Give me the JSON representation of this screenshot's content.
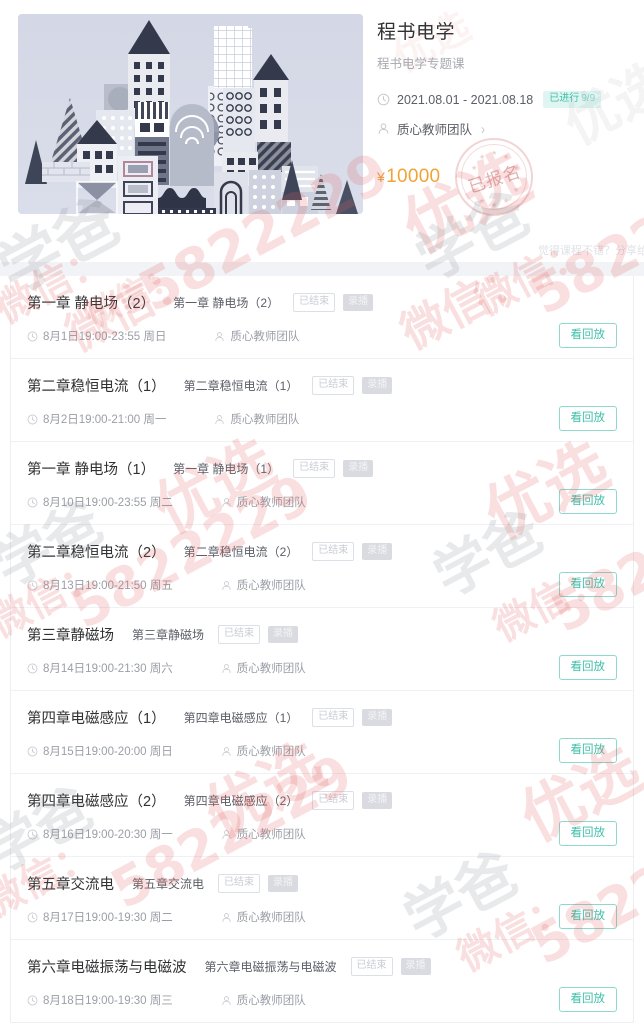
{
  "course": {
    "title": "程书电学",
    "subtitle": "程书电学专题课",
    "date_range": "2021.08.01 - 2021.08.18",
    "progress_label": "已进行",
    "progress_value": "9/9",
    "teacher": "质心教师团队",
    "chevron": "›",
    "price": "10000",
    "currency": "¥",
    "stamp_text": "已报名",
    "share_hint": "觉得课程不错？分享给",
    "clock_icon": "clock-icon",
    "person_icon": "person-icon",
    "hero_image_alt": "city-illustration"
  },
  "lessons": [
    {
      "title": "第一章 静电场（2）",
      "subtitle": "第一章 静电场（2）",
      "status_tag": "已结束",
      "type_tag": "录播",
      "datetime": "8月1日19:00-23:55 周日",
      "teacher": "质心教师团队",
      "action": "看回放"
    },
    {
      "title": "第二章稳恒电流（1）",
      "subtitle": "第二章稳恒电流（1）",
      "status_tag": "已结束",
      "type_tag": "录播",
      "datetime": "8月2日19:00-21:00 周一",
      "teacher": "质心教师团队",
      "action": "看回放"
    },
    {
      "title": "第一章 静电场（1）",
      "subtitle": "第一章 静电场（1）",
      "status_tag": "已结束",
      "type_tag": "录播",
      "datetime": "8月10日19:00-23:55 周二",
      "teacher": "质心教师团队",
      "action": "看回放"
    },
    {
      "title": "第二章稳恒电流（2）",
      "subtitle": "第二章稳恒电流（2）",
      "status_tag": "已结束",
      "type_tag": "录播",
      "datetime": "8月13日19:00-21:50 周五",
      "teacher": "质心教师团队",
      "action": "看回放"
    },
    {
      "title": "第三章静磁场",
      "subtitle": "第三章静磁场",
      "status_tag": "已结束",
      "type_tag": "录播",
      "datetime": "8月14日19:00-21:30 周六",
      "teacher": "质心教师团队",
      "action": "看回放"
    },
    {
      "title": "第四章电磁感应（1）",
      "subtitle": "第四章电磁感应（1）",
      "status_tag": "已结束",
      "type_tag": "录播",
      "datetime": "8月15日19:00-20:00 周日",
      "teacher": "质心教师团队",
      "action": "看回放"
    },
    {
      "title": "第四章电磁感应（2）",
      "subtitle": "第四章电磁感应（2）",
      "status_tag": "已结束",
      "type_tag": "录播",
      "datetime": "8月16日19:00-20:30 周一",
      "teacher": "质心教师团队",
      "action": "看回放"
    },
    {
      "title": "第五章交流电",
      "subtitle": "第五章交流电",
      "status_tag": "已结束",
      "type_tag": "录播",
      "datetime": "8月17日19:00-19:30 周二",
      "teacher": "质心教师团队",
      "action": "看回放"
    },
    {
      "title": "第六章电磁振荡与电磁波",
      "subtitle": "第六章电磁振荡与电磁波",
      "status_tag": "已结束",
      "type_tag": "录播",
      "datetime": "8月18日19:00-19:30 周三",
      "teacher": "质心教师团队",
      "action": "看回放"
    }
  ],
  "watermarks": {
    "brand": "学爸",
    "wechat": "微信：",
    "number": "5822229",
    "pick": "优选"
  },
  "colors": {
    "accent_teal": "#3fbfa9",
    "price_orange": "#f0a437",
    "badge_bg": "#dff5f1",
    "title_dark": "#303133",
    "muted": "#9a9ea6"
  }
}
